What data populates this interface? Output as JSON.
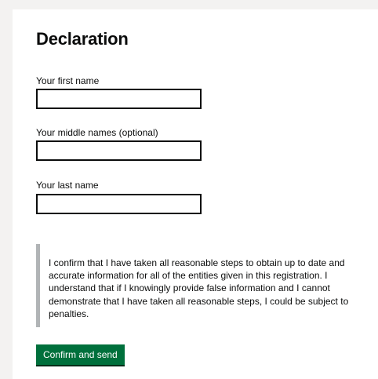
{
  "form": {
    "title": "Declaration",
    "first_name": {
      "label": "Your first name",
      "value": "",
      "placeholder": ""
    },
    "middle_names": {
      "label": "Your middle names (optional)",
      "value": "",
      "placeholder": ""
    },
    "last_name": {
      "label": "Your last name",
      "value": "",
      "placeholder": ""
    },
    "declaration_text": "I confirm that I have taken all reasonable steps to obtain up to date and accurate information for all of the entities given in this registration. I understand that if I knowingly provide false information and I cannot demonstrate that I have taken all reasonable steps, I could be subject to penalties.",
    "submit_label": "Confirm and send"
  },
  "colors": {
    "background": "#f3f2f1",
    "panel": "#ffffff",
    "text": "#0b0c0c",
    "inset_border": "#b1b4b6",
    "button": "#00703c",
    "button_shadow": "#002d18"
  }
}
